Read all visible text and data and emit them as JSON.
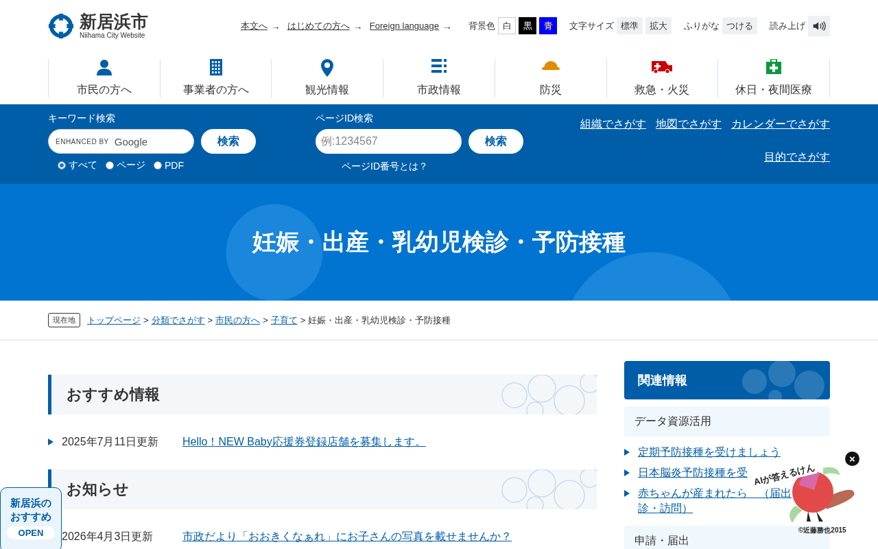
{
  "logo": {
    "name": "新居浜市",
    "subtitle": "Niihama City Website"
  },
  "utility_links": [
    "本文へ",
    "はじめての方へ",
    "Foreign language"
  ],
  "arrow": "→",
  "background_color": {
    "label": "背景色",
    "options": [
      {
        "label": "白",
        "kind": "white"
      },
      {
        "label": "黒",
        "kind": "black"
      },
      {
        "label": "青",
        "kind": "blue"
      }
    ]
  },
  "text_size": {
    "label": "文字サイズ",
    "options": [
      "標準",
      "拡大"
    ]
  },
  "furigana": {
    "label": "ふりがな",
    "button": "つける"
  },
  "read_aloud": {
    "label": "読み上げ"
  },
  "nav": [
    "市民の方へ",
    "事業者の方へ",
    "観光情報",
    "市政情報",
    "防災",
    "救急・火災",
    "休日・夜間医療"
  ],
  "keyword_search": {
    "label": "キーワード検索",
    "placeholder_prefix": "ENHANCED BY",
    "placeholder_brand": "Google",
    "button": "検索",
    "scopes": [
      {
        "label": "すべて",
        "selected": true
      },
      {
        "label": "ページ",
        "selected": false
      },
      {
        "label": "PDF",
        "selected": false
      }
    ]
  },
  "page_id_search": {
    "label": "ページID検索",
    "placeholder": "例:1234567",
    "button": "検索",
    "help": "ページID番号とは？"
  },
  "find_links": [
    "組織でさがす",
    "地図でさがす",
    "カレンダーでさがす",
    "目的でさがす"
  ],
  "page_title": "妊娠・出産・乳幼児検診・予防接種",
  "breadcrumb": {
    "label": "現在地",
    "separator": ">",
    "links": [
      "トップページ",
      "分類でさがす",
      "市民の方へ",
      "子育て"
    ],
    "current": "妊娠・出産・乳幼児検診・予防接種"
  },
  "sections": [
    {
      "title": "おすすめ情報",
      "items": [
        {
          "bullet": true,
          "date": "2025年7月11日更新",
          "link": "Hello！NEW Baby応援券登録店舗を募集します。"
        }
      ]
    },
    {
      "title": "お知らせ",
      "items": [
        {
          "bullet": false,
          "date": "2026年4月3日更新",
          "link": "市政だより「おおきくなぁれ」にお子さんの写真を載せませんか？"
        }
      ]
    }
  ],
  "sidebar": {
    "title": "関連情報",
    "category": "データ資源活用",
    "links": [
      {
        "lines": [
          "定期予防接種を受けましょう"
        ]
      },
      {
        "lines": [
          "日本脳炎予防接種を受"
        ]
      },
      {
        "lines": [
          "赤ちゃんが産まれたら　（届出",
          "診・訪問）"
        ]
      }
    ],
    "next_category": "申請・届出"
  },
  "recommend_button": {
    "lines": [
      "新居浜の",
      "おすすめ"
    ],
    "button": "OPEN"
  },
  "ai_chat": {
    "caption": "AIが答えるけん",
    "credit": "©近藤勝也2015",
    "close": "×"
  }
}
